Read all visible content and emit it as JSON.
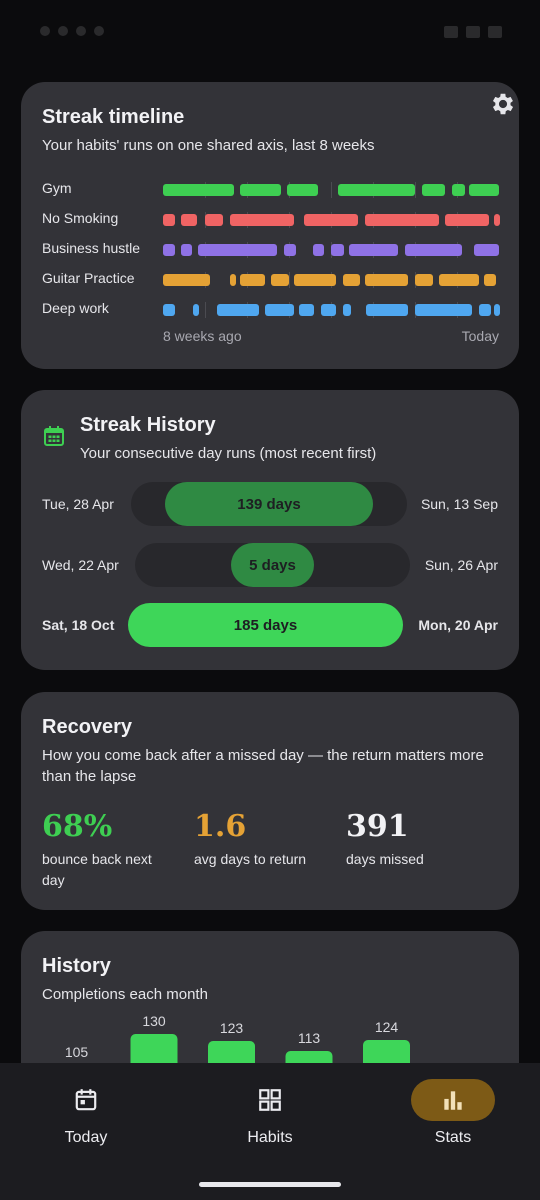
{
  "timeline": {
    "title": "Streak timeline",
    "subtitle": "Your habits' runs on one shared axis, last 8 weeks",
    "axis_start": "8 weeks ago",
    "axis_end": "Today",
    "habits": [
      {
        "name": "Gym",
        "color": "#3ecf52",
        "runs": [
          [
            0.0,
            0.21
          ],
          [
            0.23,
            0.35
          ],
          [
            0.37,
            0.46
          ],
          [
            0.52,
            0.75
          ],
          [
            0.77,
            0.84
          ],
          [
            0.86,
            0.9
          ],
          [
            0.91,
            1.0
          ]
        ]
      },
      {
        "name": "No Smoking",
        "color": "#f06464",
        "runs": [
          [
            0.0,
            0.035
          ],
          [
            0.055,
            0.1
          ],
          [
            0.125,
            0.18
          ],
          [
            0.2,
            0.39
          ],
          [
            0.42,
            0.58
          ],
          [
            0.6,
            0.82
          ],
          [
            0.84,
            0.97
          ],
          [
            0.985,
            1.0
          ]
        ]
      },
      {
        "name": "Business hustle",
        "color": "#8f72e6",
        "runs": [
          [
            0.0,
            0.035
          ],
          [
            0.055,
            0.085
          ],
          [
            0.105,
            0.34
          ],
          [
            0.36,
            0.395
          ],
          [
            0.445,
            0.48
          ],
          [
            0.5,
            0.54
          ],
          [
            0.555,
            0.7
          ],
          [
            0.72,
            0.89
          ],
          [
            0.925,
            1.0
          ]
        ]
      },
      {
        "name": "Guitar Practice",
        "color": "#e5a235",
        "runs": [
          [
            0.0,
            0.14
          ],
          [
            0.2,
            0.215
          ],
          [
            0.23,
            0.305
          ],
          [
            0.32,
            0.375
          ],
          [
            0.39,
            0.515
          ],
          [
            0.535,
            0.585
          ],
          [
            0.6,
            0.73
          ],
          [
            0.75,
            0.805
          ],
          [
            0.82,
            0.94
          ],
          [
            0.955,
            0.99
          ]
        ]
      },
      {
        "name": "Deep work",
        "color": "#4fa7f0",
        "runs": [
          [
            0.0,
            0.035
          ],
          [
            0.09,
            0.105
          ],
          [
            0.16,
            0.285
          ],
          [
            0.305,
            0.39
          ],
          [
            0.405,
            0.45
          ],
          [
            0.47,
            0.515
          ],
          [
            0.535,
            0.56
          ],
          [
            0.605,
            0.73
          ],
          [
            0.75,
            0.92
          ],
          [
            0.94,
            0.975
          ],
          [
            0.985,
            1.0
          ]
        ]
      }
    ]
  },
  "streak_history": {
    "title": "Streak History",
    "subtitle": "Your consecutive day runs (most recent first)",
    "streaks": [
      {
        "start": "Tue, 28 Apr",
        "end": "Sun, 13 Sep",
        "label": "139 days",
        "fraction": 0.751,
        "color": "#2f8a43",
        "highlight": false
      },
      {
        "start": "Wed, 22 Apr",
        "end": "Sun, 26 Apr",
        "label": "5 days",
        "fraction": 0.3,
        "color": "#2f8a43",
        "highlight": false
      },
      {
        "start": "Sat, 18 Oct",
        "end": "Mon, 20 Apr",
        "label": "185 days",
        "fraction": 1.0,
        "color": "#3ed659",
        "highlight": true
      }
    ]
  },
  "recovery": {
    "title": "Recovery",
    "subtitle": "How you come back after a missed day — the return matters more than the lapse",
    "stats": [
      {
        "value": "68%",
        "label": "bounce back next day",
        "color": "#3ecf52"
      },
      {
        "value": "1.6",
        "label": "avg days to return",
        "color": "#e5a235"
      },
      {
        "value": "391",
        "label": "days missed",
        "color": "#f2f2f5"
      }
    ]
  },
  "history": {
    "title": "History",
    "subtitle": "Completions each month"
  },
  "chart_data": {
    "type": "bar",
    "title": "History",
    "subtitle": "Completions each month",
    "values": [
      105,
      130,
      123,
      113,
      124
    ],
    "color": "#3ed659",
    "ylim": [
      0,
      130
    ]
  },
  "nav": {
    "items": [
      {
        "label": "Today",
        "icon": "calendar-icon",
        "active": false
      },
      {
        "label": "Habits",
        "icon": "grid-icon",
        "active": false
      },
      {
        "label": "Stats",
        "icon": "bar-chart-icon",
        "active": true
      }
    ]
  }
}
